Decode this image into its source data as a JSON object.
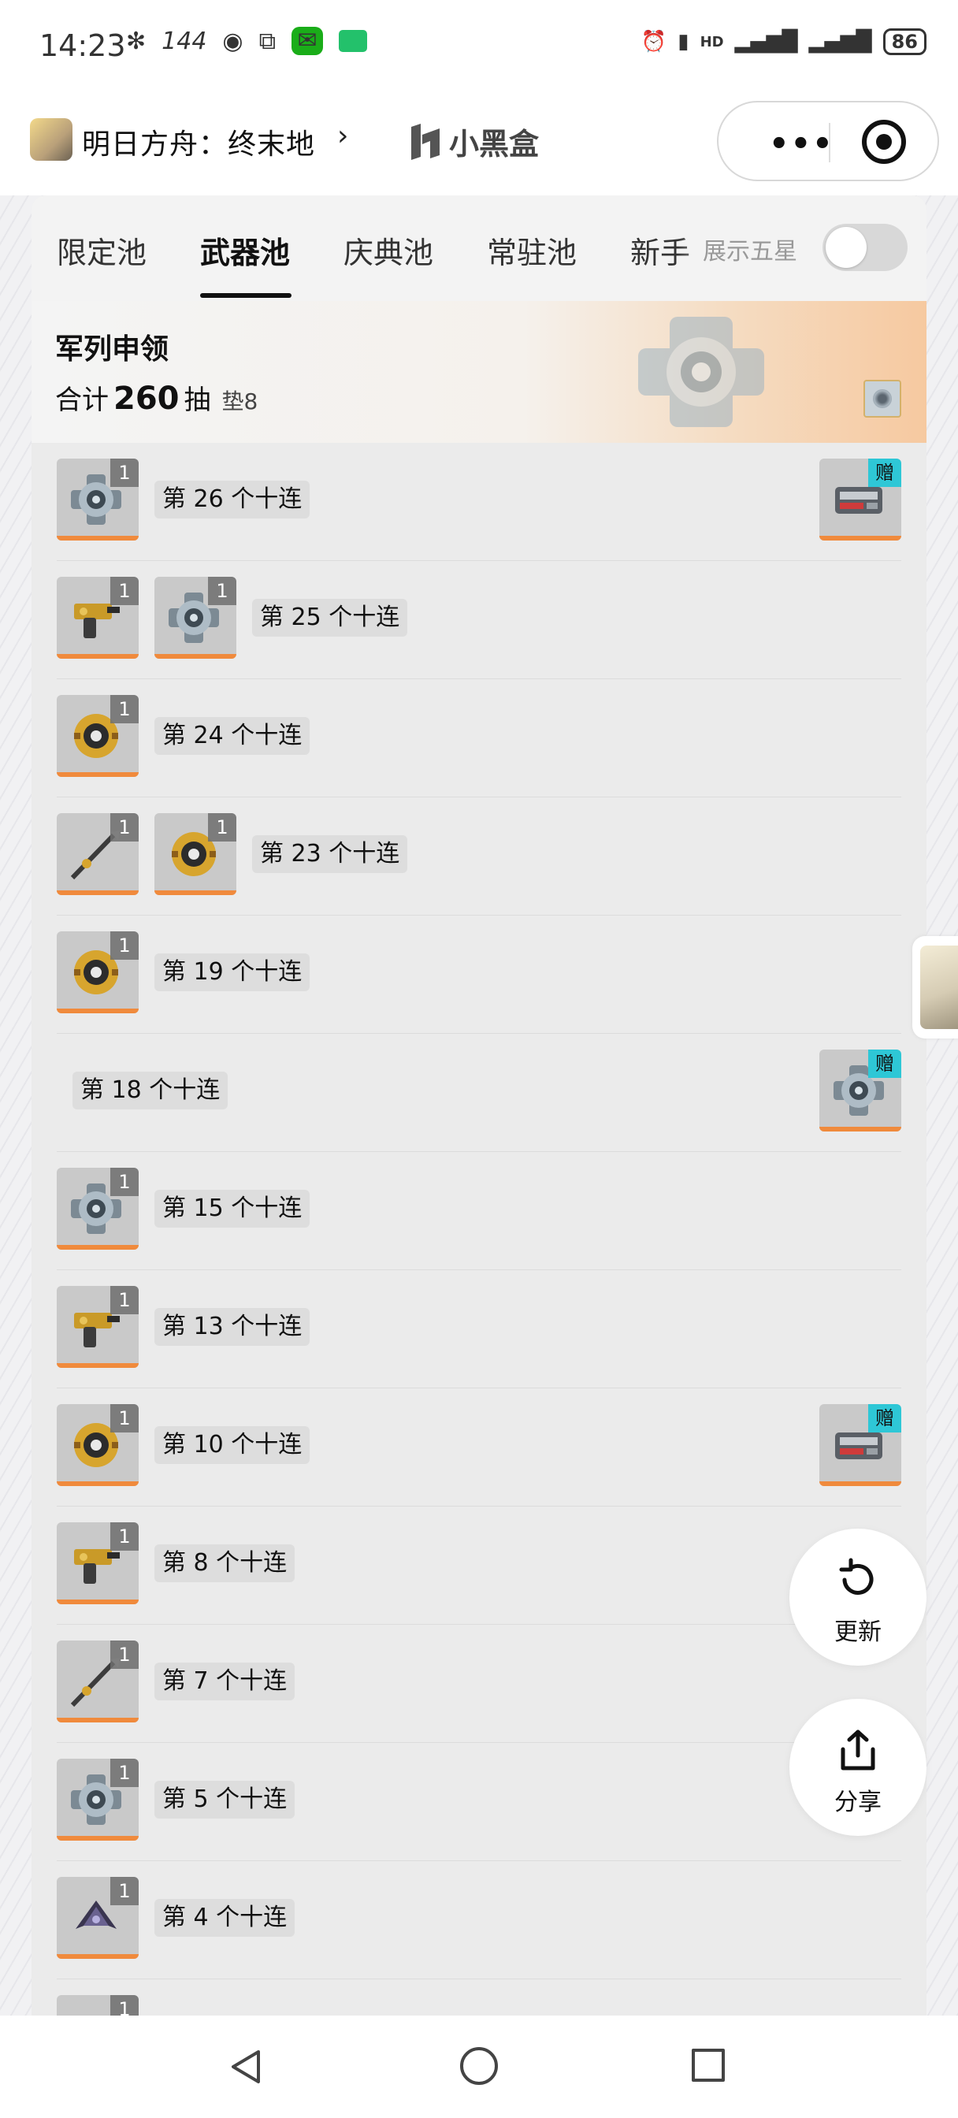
{
  "status_bar": {
    "time": "14:23",
    "refresh_rate": "144",
    "battery": "86"
  },
  "header": {
    "title": "明日方舟：终末地",
    "chevron": "›",
    "brand": "小黑盒",
    "menu_dots": "•••"
  },
  "tabs": [
    {
      "label": "限定池"
    },
    {
      "label": "武器池"
    },
    {
      "label": "庆典池"
    },
    {
      "label": "常驻池"
    },
    {
      "label": "新手"
    }
  ],
  "active_tab": "武器池",
  "toggle": {
    "label": "展示五星",
    "on": false
  },
  "banner": {
    "title": "军列申领",
    "total_prefix": "合计",
    "total_count": "260",
    "total_unit": "抽",
    "pity": "垫8"
  },
  "rows": [
    {
      "label": "第 26 个十连",
      "items": [
        {
          "icon": "gear-core-icon",
          "count": "1"
        }
      ],
      "gift": {
        "icon": "cargo-case-icon",
        "tag": "赠"
      }
    },
    {
      "label": "第 25 个十连",
      "items": [
        {
          "icon": "heavy-gun-icon",
          "count": "1"
        },
        {
          "icon": "gear-core-icon",
          "count": "1"
        }
      ]
    },
    {
      "label": "第 24 个十连",
      "items": [
        {
          "icon": "yellow-orb-icon",
          "count": "1"
        }
      ]
    },
    {
      "label": "第 23 个十连",
      "items": [
        {
          "icon": "spear-icon",
          "count": "1"
        },
        {
          "icon": "yellow-orb-icon",
          "count": "1"
        }
      ]
    },
    {
      "label": "第 19 个十连",
      "items": [
        {
          "icon": "yellow-orb-icon",
          "count": "1"
        }
      ]
    },
    {
      "label": "第 18 个十连",
      "items": [],
      "gift": {
        "icon": "gear-core-icon",
        "tag": "赠"
      }
    },
    {
      "label": "第 15 个十连",
      "items": [
        {
          "icon": "gear-core-icon",
          "count": "1"
        }
      ]
    },
    {
      "label": "第 13 个十连",
      "items": [
        {
          "icon": "heavy-gun-icon",
          "count": "1"
        }
      ]
    },
    {
      "label": "第 10 个十连",
      "items": [
        {
          "icon": "yellow-orb-icon",
          "count": "1"
        }
      ],
      "gift": {
        "icon": "cargo-case-icon",
        "tag": "赠"
      }
    },
    {
      "label": "第 8 个十连",
      "items": [
        {
          "icon": "heavy-gun-icon",
          "count": "1"
        }
      ]
    },
    {
      "label": "第 7 个十连",
      "items": [
        {
          "icon": "spear-icon",
          "count": "1"
        }
      ]
    },
    {
      "label": "第 5 个十连",
      "items": [
        {
          "icon": "gear-core-icon",
          "count": "1"
        }
      ]
    },
    {
      "label": "第 4 个十连",
      "items": [
        {
          "icon": "dark-blade-icon",
          "count": "1"
        }
      ]
    },
    {
      "label": "",
      "items": [
        {
          "icon": "partial-item-icon",
          "count": "1"
        }
      ]
    }
  ],
  "fabs": {
    "refresh_label": "更新",
    "share_label": "分享"
  },
  "colors": {
    "accent_orange": "#f08a3c",
    "gift_tag": "#2ec7d6",
    "card_bg": "#ebebeb"
  }
}
